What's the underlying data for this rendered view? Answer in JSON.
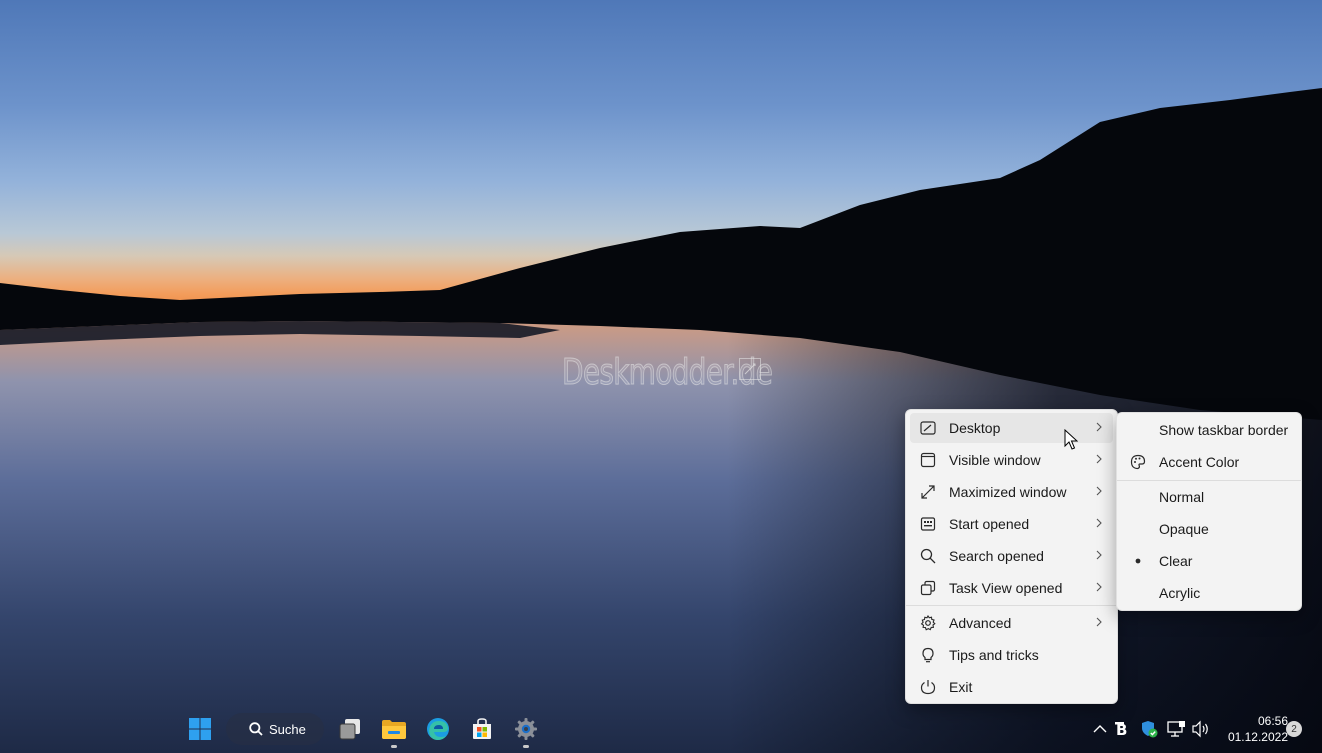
{
  "desktop": {
    "watermark": "Deskmodder.de"
  },
  "taskbar": {
    "search_label": "Suche",
    "apps": [
      {
        "icon": "windows-start-icon"
      },
      {
        "icon": "task-view-icon"
      },
      {
        "icon": "file-explorer-icon"
      },
      {
        "icon": "edge-icon"
      },
      {
        "icon": "microsoft-store-icon"
      },
      {
        "icon": "settings-gear-icon"
      }
    ],
    "tray": {
      "time": "06:56",
      "date": "01.12.2022",
      "notifications": "2"
    }
  },
  "context_menu": {
    "items": [
      {
        "label": "Desktop",
        "icon": "desktop-icon",
        "submenu": true
      },
      {
        "label": "Visible window",
        "icon": "window-icon",
        "submenu": true
      },
      {
        "label": "Maximized window",
        "icon": "maximize-icon",
        "submenu": true
      },
      {
        "label": "Start opened",
        "icon": "start-icon",
        "submenu": true
      },
      {
        "label": "Search opened",
        "icon": "search-icon",
        "submenu": true
      },
      {
        "label": "Task View opened",
        "icon": "task-view-icon",
        "submenu": true
      },
      {
        "label": "Advanced",
        "icon": "gear-icon",
        "submenu": true
      },
      {
        "label": "Tips and tricks",
        "icon": "lightbulb-icon",
        "submenu": false
      },
      {
        "label": "Exit",
        "icon": "power-icon",
        "submenu": false
      }
    ]
  },
  "submenu": {
    "items": [
      {
        "label": "Show taskbar border"
      },
      {
        "label": "Accent Color",
        "icon": "palette-icon"
      },
      {
        "label": "Normal"
      },
      {
        "label": "Opaque"
      },
      {
        "label": "Clear",
        "selected": true
      },
      {
        "label": "Acrylic"
      }
    ]
  },
  "colors": {
    "sky_top": "#4f78b8",
    "horizon": "#f08f4a",
    "menu_bg": "#f3f3f3",
    "accent": "#0078d4"
  }
}
